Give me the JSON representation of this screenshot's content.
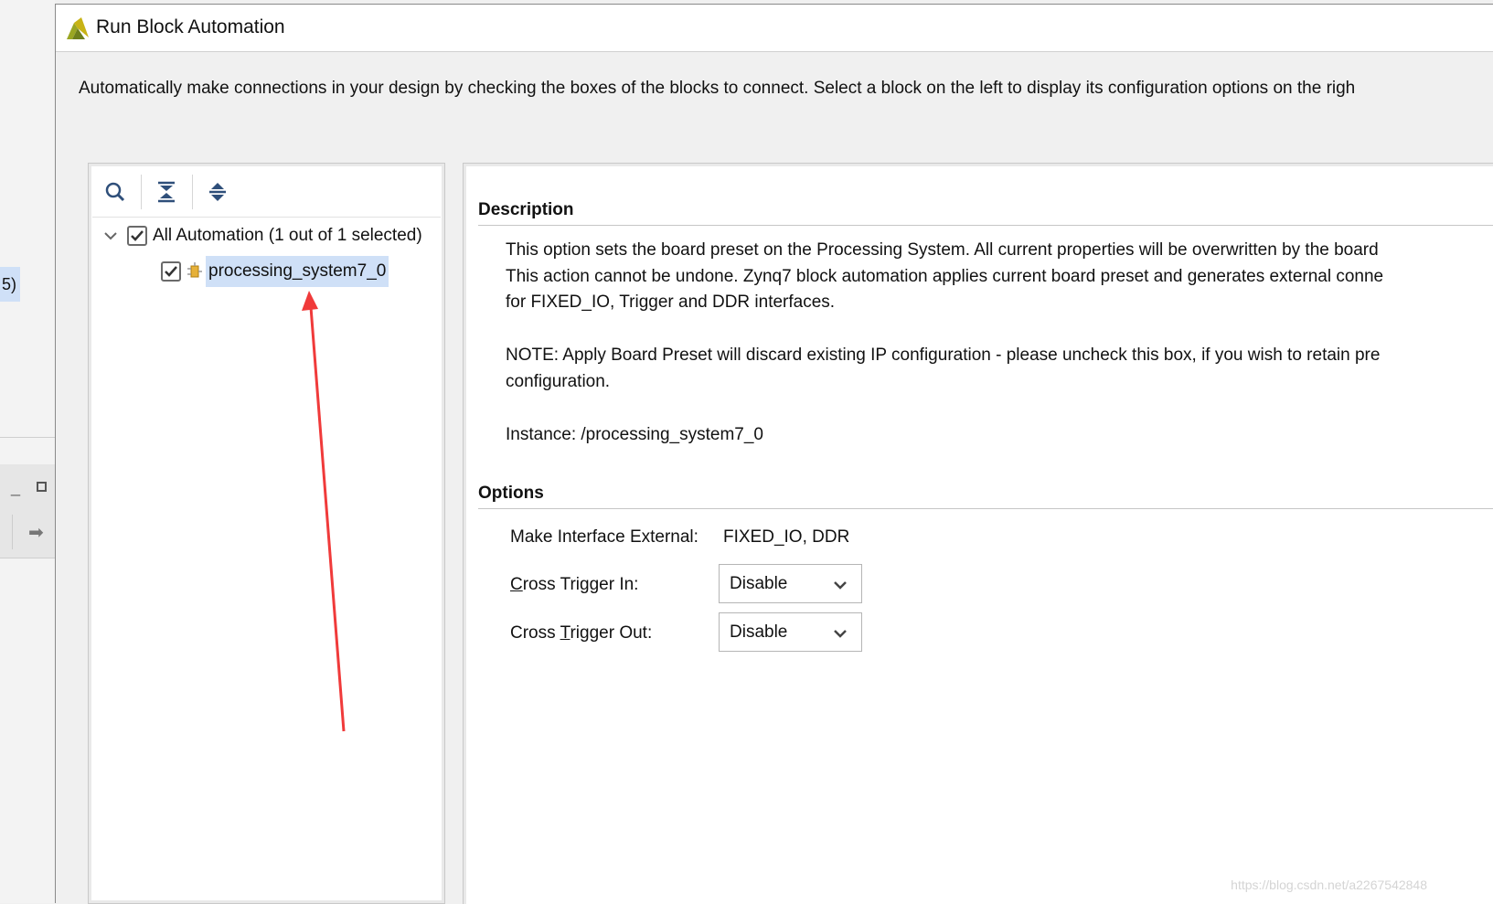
{
  "background": {
    "badge_text": "5)"
  },
  "dialog": {
    "title": "Run Block Automation",
    "intro": "Automatically make connections in your design by checking the boxes of the blocks to connect. Select a block on the left to display its configuration options on the righ"
  },
  "tree": {
    "toolbar": [
      "search-icon",
      "collapse-all-icon",
      "expand-all-icon"
    ],
    "root_label": "All Automation (1 out of 1 selected)",
    "root_checked": true,
    "child_label": "processing_system7_0",
    "child_checked": true
  },
  "description": {
    "heading": "Description",
    "lines": [
      "This option sets the board preset on the Processing System. All current properties will be overwritten by the board",
      "This action cannot be undone. Zynq7 block automation applies current board preset and generates external conne",
      "for FIXED_IO, Trigger and DDR interfaces."
    ],
    "note_lines": [
      "NOTE: Apply Board Preset will discard existing IP configuration - please uncheck this box, if you wish to retain pre",
      "configuration."
    ],
    "instance": "Instance: /processing_system7_0"
  },
  "options": {
    "heading": "Options",
    "make_external_label": "Make Interface External:",
    "make_external_value": "FIXED_IO, DDR",
    "cross_trigger_in": {
      "label_mnemonic": "C",
      "label_rest": "ross Trigger In:",
      "value": "Disable"
    },
    "cross_trigger_out": {
      "label_prefix": "Cross ",
      "label_mnemonic": "T",
      "label_rest": "rigger Out:",
      "value": "Disable"
    }
  },
  "watermark": "https://blog.csdn.net/a2267542848",
  "colors": {
    "selection": "#cfe0f7",
    "annotation_arrow": "#f03a3a"
  }
}
